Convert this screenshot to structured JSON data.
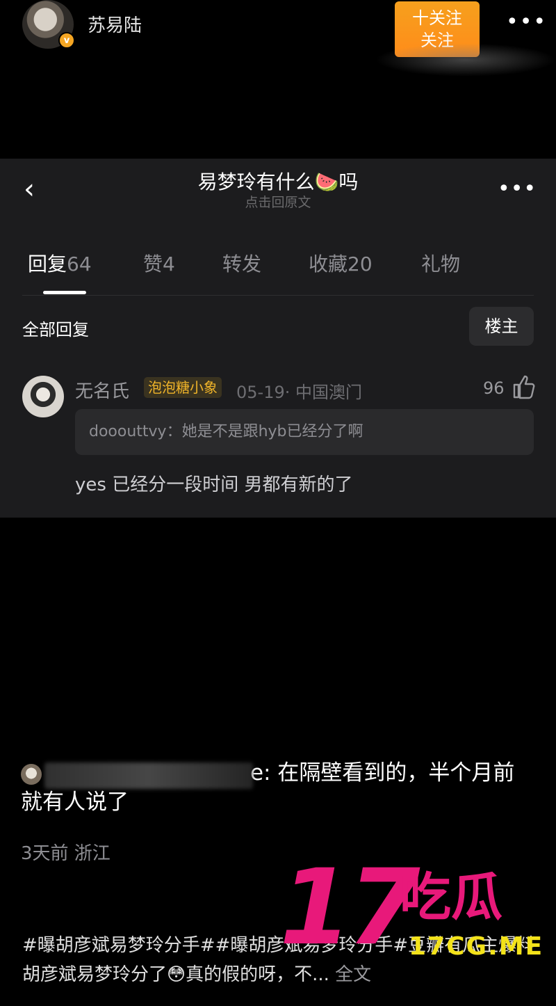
{
  "header": {
    "username": "苏易陆",
    "verified_badge": "v",
    "follow_label_1": "十关注",
    "follow_label_2": "关注",
    "more": "•••"
  },
  "post": {
    "back": "‹",
    "title": "易梦玲有什么🍉吗",
    "subtitle": "点击回原文",
    "more": "•••"
  },
  "tabs": [
    {
      "label": "回复",
      "count": "64"
    },
    {
      "label": "赞",
      "count": "4"
    },
    {
      "label": "转发",
      "count": ""
    },
    {
      "label": "收藏",
      "count": "20"
    },
    {
      "label": "礼物",
      "count": ""
    }
  ],
  "replies": {
    "section_title": "全部回复",
    "filter_button": "楼主"
  },
  "comment": {
    "name": "无名氏",
    "badge": "泡泡糖小象",
    "meta": "05-19· 中国澳门",
    "likes": "96",
    "quote": "dooouttvy：她是不是跟hyb已经分了啊",
    "text": "yes 已经分一段时间 男都有新的了"
  },
  "bottom_comment": {
    "text": "e: 在隔壁看到的，半个月前就有人说了",
    "meta": "3天前 浙江"
  },
  "hashtags": {
    "text": "#曝胡彦斌易梦玲分手##曝胡彦斌易梦玲分手#豆瓣有瓜主爆料胡彦斌易梦玲分了😳真的假的呀，不...",
    "full_text": "全文"
  },
  "watermark": {
    "number": "17",
    "chinese": "吃瓜",
    "url": "17CG.ME"
  },
  "colors": {
    "accent_orange": "#f6a01d",
    "badge_gold": "#f0b429",
    "watermark_pink": "#e8197a",
    "watermark_yellow": "#f3e21a"
  }
}
